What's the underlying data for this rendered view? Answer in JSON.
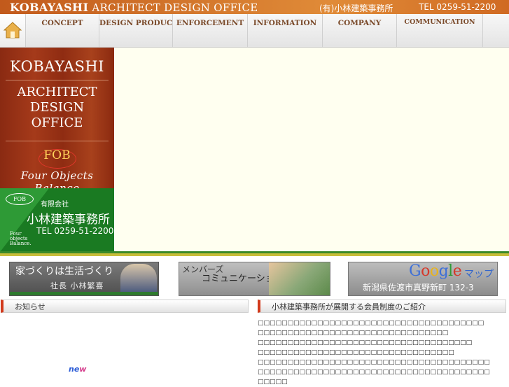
{
  "header": {
    "brand_main": "KOBAYASHI",
    "brand_rest": "ARCHITECT DESIGN OFFICE",
    "company_jp": "(有)小林建築事務所",
    "tel": "TEL 0259-51-2200"
  },
  "nav": {
    "items": [
      {
        "label": "CONCEPT"
      },
      {
        "label": "DESIGN PRODUCT"
      },
      {
        "label": "ENFORCEMENT"
      },
      {
        "label": "INFORMATION"
      },
      {
        "label": "COMPANY"
      },
      {
        "label": "COMMUNICATION"
      }
    ]
  },
  "logo_panel": {
    "name": "KOBAYASHI",
    "line1": "ARCHITECT",
    "line2": "DESIGN",
    "line3": "OFFICE",
    "fob": "FOB",
    "fob_sub": "Four Objects Balance",
    "badge": "FOB",
    "company_type": "有限会社",
    "company_name": "小林建築事務所",
    "tel": "TEL 0259-51-2200",
    "four1": "Four",
    "four2": "objects",
    "four3": "Balance."
  },
  "banners": {
    "president": {
      "line1": "家づくりは生活づくり",
      "line2": "社長 小林繁喜"
    },
    "members": {
      "line1": "メンバーズ",
      "line2": "コミュニケーション"
    },
    "map": {
      "logo": "Google",
      "map_label": "マップ",
      "address": "新潟県佐渡市真野新町 132-3"
    }
  },
  "sections": {
    "news_title": "お知らせ",
    "members_title": "小林建築事務所が展開する会員制度のご紹介",
    "new_badge_a": "ne",
    "new_badge_b": "w"
  },
  "intro_lines": [
    "□□□□□□□□□□□□□□□□□□□□□□□□□□□□□□□□□□□□□□",
    "□□□□□□□□□□□□□□□□□□□□□□□□□□□□□□□□",
    "□□□□□□□□□□□□□□□□□□□□□□□□□□□□□□□□□□□□",
    "□□□□□□□□□□□□□□□□□□□□□□□□□□□□□□□□□",
    "□□□□□□□□□□□□□□□□□□□□□□□□□□□□□□□□□□□□□□□",
    "□□□□□□□□□□□□□□□□□□□□□□□□□□□□□□□□□□□□□□□",
    "□□□□□"
  ],
  "colors": {
    "header_orange": "#d2752b",
    "logo_red": "#a53a1a",
    "logo_green": "#1a7a22",
    "divider_green": "#3a8a2a",
    "accent_red": "#d23a1c"
  }
}
